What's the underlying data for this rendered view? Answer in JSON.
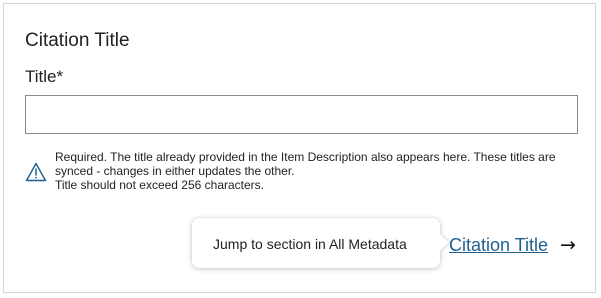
{
  "section": {
    "title": "Citation Title"
  },
  "field": {
    "label": "Title*",
    "value": "",
    "placeholder": ""
  },
  "help": {
    "icon": "warning-triangle-icon",
    "line1": "Required. The title already provided in the Item Description also appears here. These titles are synced - changes in either updates the other.",
    "line2": "Title should not exceed 256 characters."
  },
  "tooltip": {
    "text": "Jump to section in All Metadata"
  },
  "jump_link": {
    "label": "Citation Title",
    "arrow": "→",
    "icon": "arrow-right-icon"
  },
  "colors": {
    "link": "#1f5f8f",
    "warning_icon": "#1f5f8f",
    "border": "#d6d6d6",
    "input_border": "#8a8a8a"
  }
}
